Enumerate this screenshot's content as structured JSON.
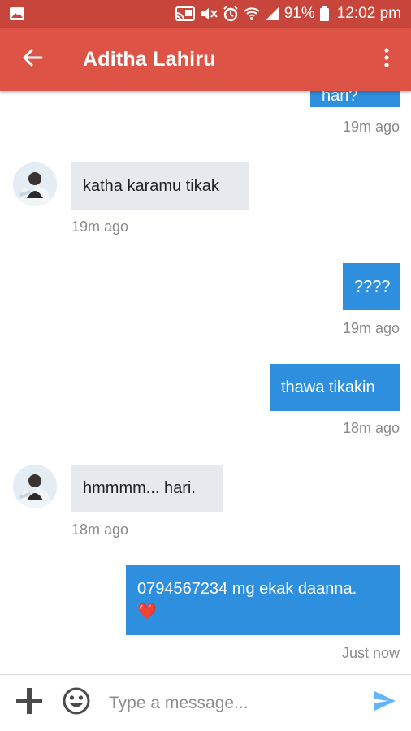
{
  "status_bar": {
    "battery": "91%",
    "time": "12:02 pm"
  },
  "app_bar": {
    "title": "Aditha Lahiru"
  },
  "messages": [
    {
      "direction": "outgoing",
      "text": "hari hari?",
      "time": "19m ago"
    },
    {
      "direction": "incoming",
      "text": "katha karamu tikak",
      "time": "19m ago"
    },
    {
      "direction": "outgoing",
      "text": "????",
      "time": "19m ago"
    },
    {
      "direction": "outgoing",
      "text": "thawa tikakin",
      "time": "18m ago"
    },
    {
      "direction": "incoming",
      "text": "hmmmm... hari.",
      "time": "18m ago"
    },
    {
      "direction": "outgoing",
      "text": "0794567234 mg ekak daanna.",
      "emoji": "❤️",
      "time": "Just now"
    }
  ],
  "composer": {
    "placeholder": "Type a message..."
  },
  "colors": {
    "status_bar": "#c8453b",
    "app_bar": "#dd5346",
    "outgoing_bubble": "#2e8fde",
    "incoming_bubble": "#e6e9ee",
    "send_icon": "#64b5f6"
  },
  "icons": [
    "image-icon",
    "cast-icon",
    "mute-icon",
    "alarm-icon",
    "wifi-icon",
    "signal-icon",
    "battery-icon",
    "back-arrow-icon",
    "more-vert-icon",
    "add-icon",
    "emoji-icon",
    "send-icon"
  ]
}
